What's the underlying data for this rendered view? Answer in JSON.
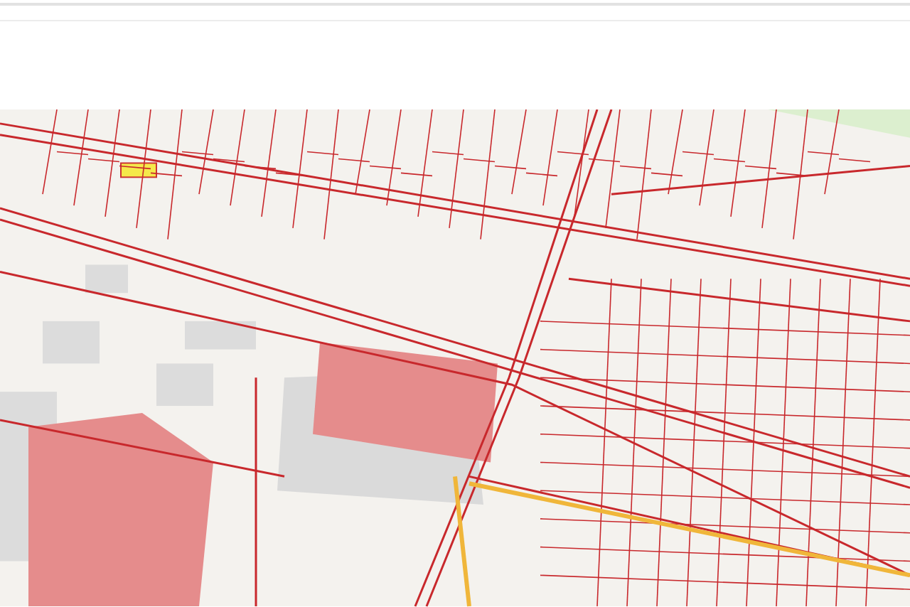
{
  "map": {
    "kind": "cadastral"
  }
}
